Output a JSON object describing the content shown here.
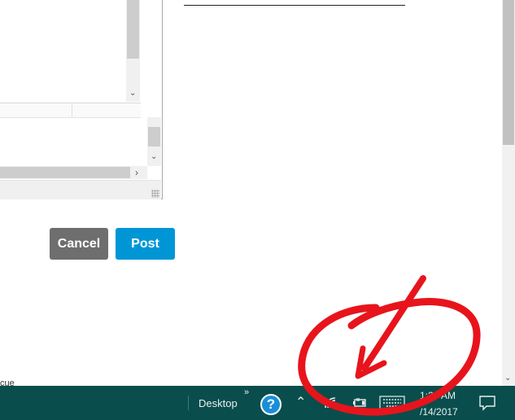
{
  "buttons": {
    "cancel": "Cancel",
    "post": "Post"
  },
  "stray_text": "cue",
  "taskbar": {
    "toolbar_label": "Desktop",
    "toolbar_chevron": "»",
    "help_glyph": "?",
    "time": "1:28 AM",
    "date": "/14/2017"
  },
  "icons": [
    "scroll-down-arrow-icon",
    "scroll-right-arrow-icon",
    "resize-grip-icon",
    "help-icon",
    "tray-chevron-up-icon",
    "wifi-icon",
    "battery-icon",
    "touch-keyboard-icon",
    "action-center-icon"
  ],
  "colors": {
    "taskbar": "#0a4d4d",
    "post_button": "#0096d6",
    "cancel_button": "#6e6e6e",
    "annotation": "#e8141c"
  }
}
